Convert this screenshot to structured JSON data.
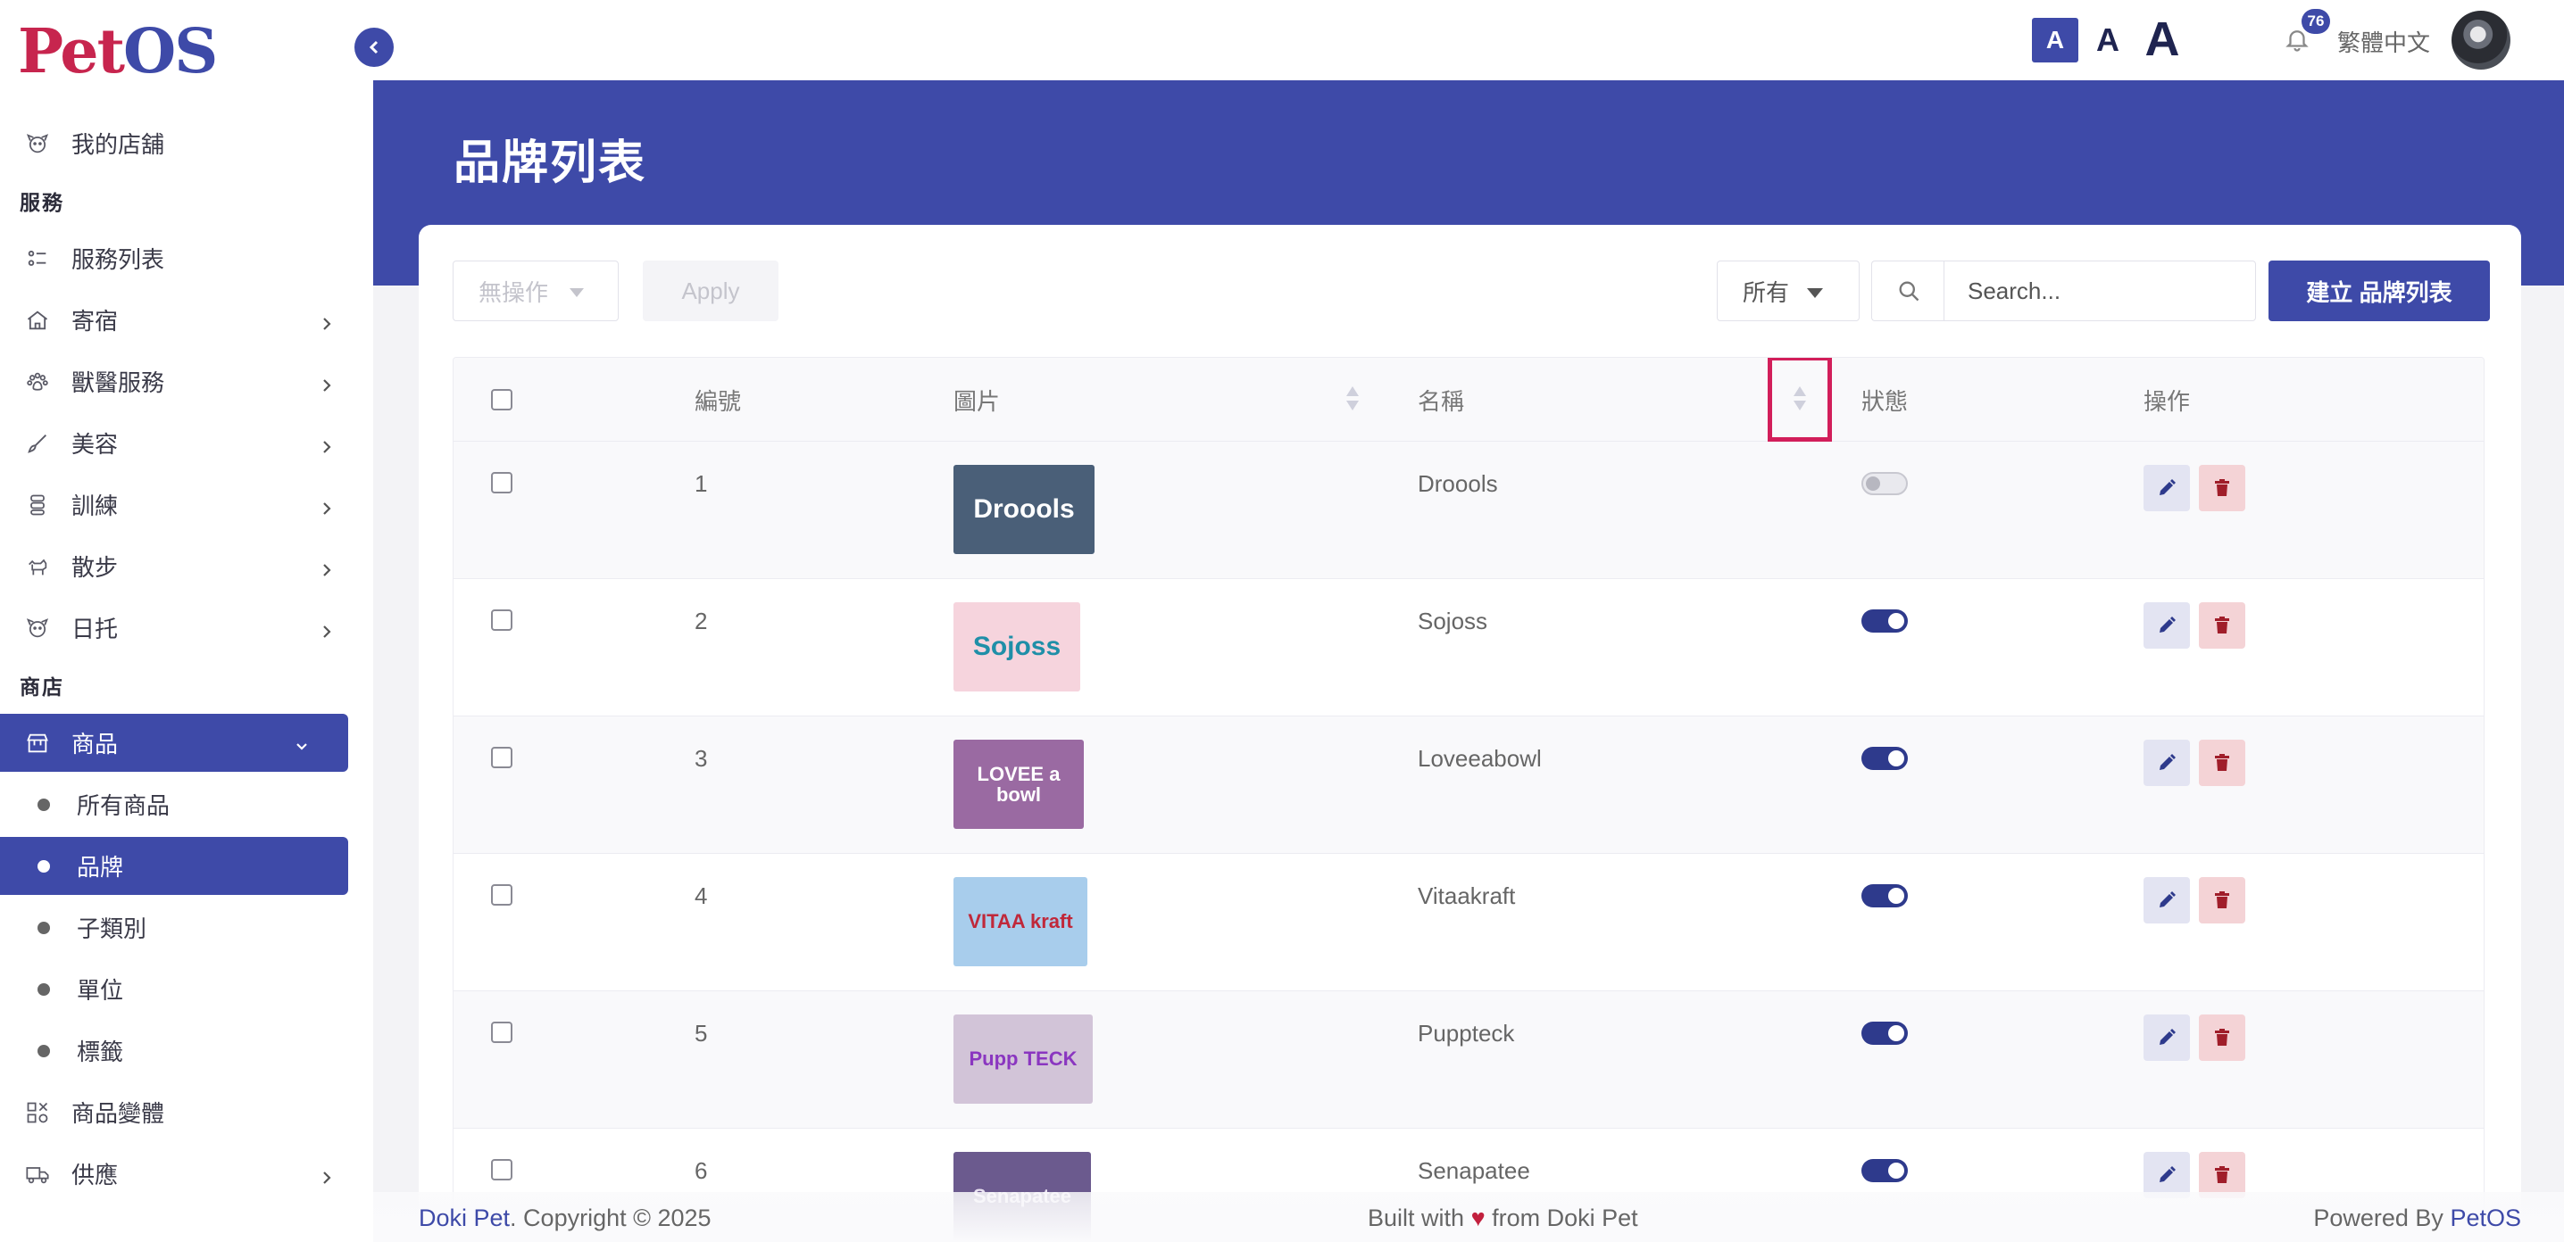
{
  "logo": {
    "part1": "Pet",
    "part2": "OS"
  },
  "sidebar": {
    "my_store": "我的店舖",
    "section_services": "服務",
    "items_services": [
      {
        "label": "服務列表",
        "icon": "list-icon",
        "has_chevron": false
      },
      {
        "label": "寄宿",
        "icon": "house-icon",
        "has_chevron": true
      },
      {
        "label": "獸醫服務",
        "icon": "paw-icon",
        "has_chevron": true
      },
      {
        "label": "美容",
        "icon": "brush-icon",
        "has_chevron": true
      },
      {
        "label": "訓練",
        "icon": "leash-icon",
        "has_chevron": true
      },
      {
        "label": "散步",
        "icon": "dog-icon",
        "has_chevron": true
      },
      {
        "label": "日托",
        "icon": "pet-face-icon",
        "has_chevron": true
      }
    ],
    "section_store": "商店",
    "products": "商品",
    "product_sub": [
      "所有商品",
      "品牌",
      "子類別",
      "單位",
      "標籤"
    ],
    "product_variants": "商品變體",
    "supply": "供應"
  },
  "topbar": {
    "font_small": "A",
    "font_medium": "A",
    "font_large": "A",
    "notification_count": "76",
    "language": "繁體中文"
  },
  "page": {
    "title": "品牌列表"
  },
  "toolbar": {
    "bulk_action": "無操作",
    "apply": "Apply",
    "filter": "所有",
    "search_placeholder": "Search...",
    "create": "建立 品牌列表"
  },
  "table": {
    "headers": {
      "id": "編號",
      "image": "圖片",
      "name": "名稱",
      "status": "狀態",
      "actions": "操作"
    },
    "rows": [
      {
        "id": "1",
        "name": "Droools",
        "logo_text": "Droools",
        "status": false,
        "bg": "#4a5f78",
        "fg": "#ffffff"
      },
      {
        "id": "2",
        "name": "Sojoss",
        "logo_text": "Sojoss",
        "status": true,
        "bg": "#f6d4dd",
        "fg": "#1f8fa8"
      },
      {
        "id": "3",
        "name": "Loveeabowl",
        "logo_text": "LOVEE a bowl",
        "status": true,
        "bg": "#9a6aa2",
        "fg": "#ffffff"
      },
      {
        "id": "4",
        "name": "Vitaakraft",
        "logo_text": "VITAA kraft",
        "status": true,
        "bg": "#a8cdec",
        "fg": "#c0283a"
      },
      {
        "id": "5",
        "name": "Puppteck",
        "logo_text": "Pupp TECK",
        "status": true,
        "bg": "#d2c4d8",
        "fg": "#8a36c0"
      },
      {
        "id": "6",
        "name": "Senapatee",
        "logo_text": "Senapatee",
        "status": true,
        "bg": "#6b5a8e",
        "fg": "#e8e0f0"
      }
    ]
  },
  "footer": {
    "brand": "Doki Pet",
    "copyright": ". Copyright © 2025",
    "built_prefix": "Built with",
    "heart": "♥",
    "built_suffix": "from Doki Pet",
    "powered_prefix": "Powered By",
    "powered_brand": "PetOS"
  },
  "colors": {
    "primary": "#3e4aa8",
    "danger": "#a01e2a",
    "highlight": "#d21e5a"
  }
}
